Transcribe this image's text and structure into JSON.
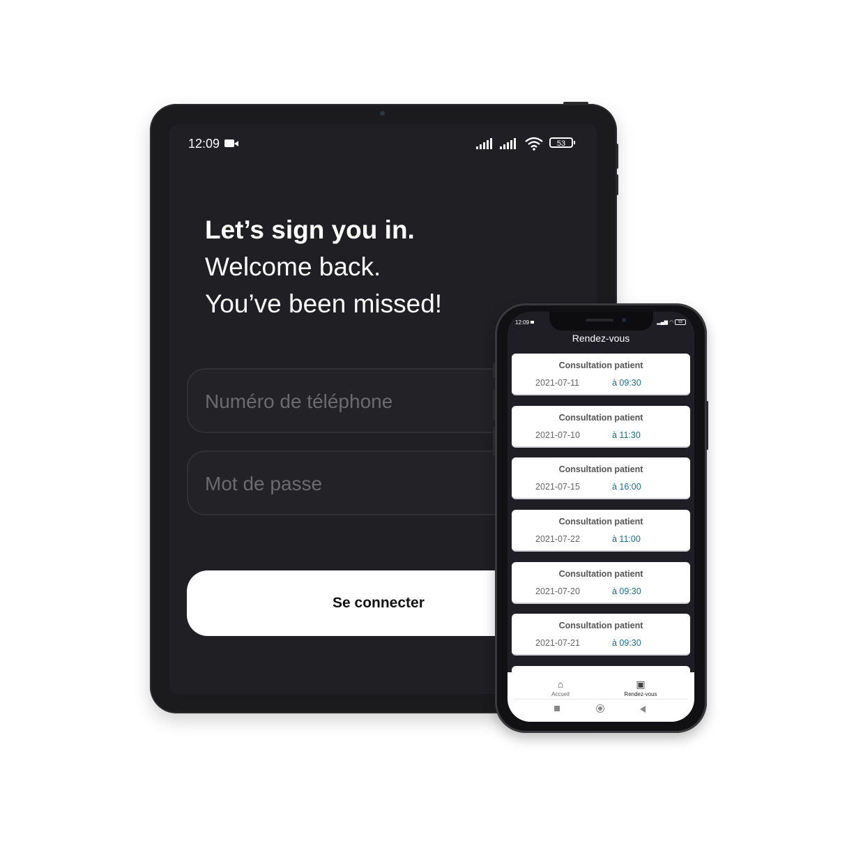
{
  "tablet": {
    "status": {
      "time": "12:09",
      "battery": "53"
    },
    "headline": {
      "line1": "Let’s sign you in.",
      "line2": "Welcome back.",
      "line3": "You’ve been missed!"
    },
    "phone_field": {
      "placeholder": "Numéro de téléphone"
    },
    "password_field": {
      "placeholder": "Mot de passe"
    },
    "submit_label": "Se connecter"
  },
  "phone": {
    "status": {
      "time": "12:09",
      "battery": "53"
    },
    "title": "Rendez-vous",
    "appointments": [
      {
        "title": "Consultation patient",
        "date": "2021-07-11",
        "time": "à 09:30"
      },
      {
        "title": "Consultation patient",
        "date": "2021-07-10",
        "time": "à 11:30"
      },
      {
        "title": "Consultation patient",
        "date": "2021-07-15",
        "time": "à 16:00"
      },
      {
        "title": "Consultation patient",
        "date": "2021-07-22",
        "time": "à 11:00"
      },
      {
        "title": "Consultation patient",
        "date": "2021-07-20",
        "time": "à 09:30"
      },
      {
        "title": "Consultation patient",
        "date": "2021-07-21",
        "time": "à 09:30"
      }
    ],
    "nav": {
      "home": {
        "label": "Accueil",
        "icon": "home-icon"
      },
      "appointments": {
        "label": "Rendez-vous",
        "icon": "calendar-icon"
      }
    },
    "colors": {
      "accent": "#1b6e8a",
      "background": "#1e1e24",
      "card": "#ffffff"
    }
  }
}
